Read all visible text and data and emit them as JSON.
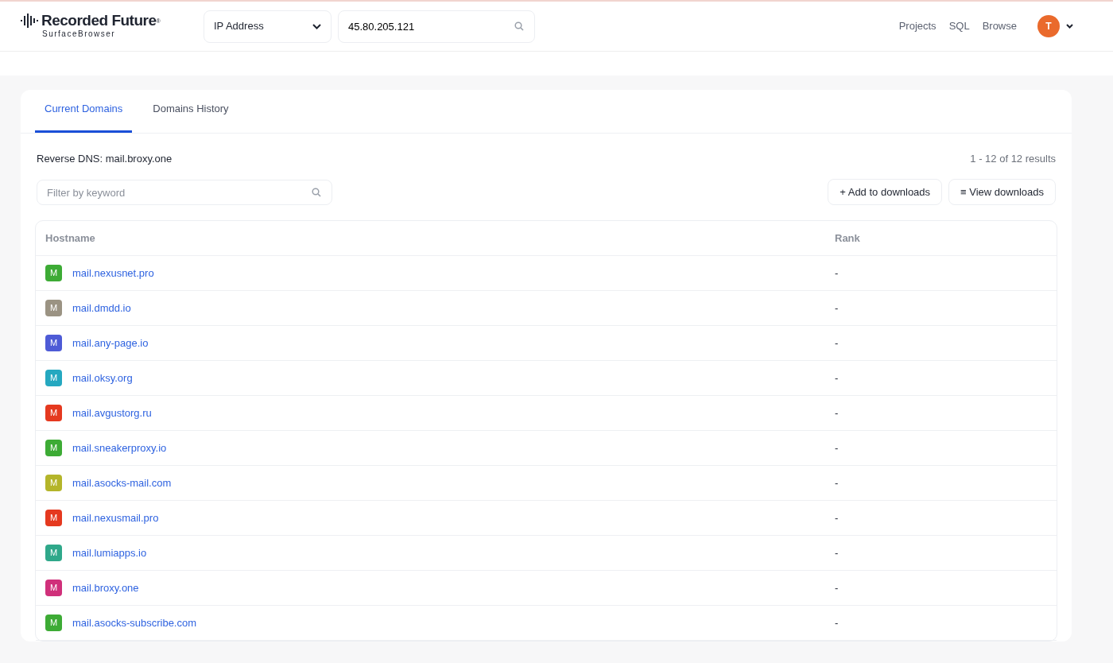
{
  "header": {
    "logo_name": "Recorded Future",
    "logo_mark": "®",
    "logo_product": "SurfaceBrowser",
    "search_type": "IP Address",
    "search_value": "45.80.205.121",
    "nav": [
      "Projects",
      "SQL",
      "Browse"
    ],
    "avatar": "T"
  },
  "tabs": [
    {
      "label": "Current Domains",
      "selected": true
    },
    {
      "label": "Domains History",
      "selected": false
    }
  ],
  "reverse_dns": {
    "label": "Reverse DNS:",
    "value": "mail.broxy.one"
  },
  "results": "1 - 12 of 12 results",
  "filter": {
    "placeholder": "Filter by keyword"
  },
  "buttons": [
    {
      "icon": "+",
      "label": "Add to downloads"
    },
    {
      "icon": "≡",
      "label": "View downloads"
    }
  ],
  "table": {
    "columns": [
      "Hostname",
      "Rank"
    ],
    "rows": [
      {
        "letter": "M",
        "color": "#3dab35",
        "hostname": "mail.nexusnet.pro",
        "rank": "-"
      },
      {
        "letter": "M",
        "color": "#9b9383",
        "hostname": "mail.dmdd.io",
        "rank": "-"
      },
      {
        "letter": "M",
        "color": "#4e5bd6",
        "hostname": "mail.any-page.io",
        "rank": "-"
      },
      {
        "letter": "M",
        "color": "#25a8c0",
        "hostname": "mail.oksy.org",
        "rank": "-"
      },
      {
        "letter": "M",
        "color": "#e5391f",
        "hostname": "mail.avgustorg.ru",
        "rank": "-"
      },
      {
        "letter": "M",
        "color": "#3dab35",
        "hostname": "mail.sneakerproxy.io",
        "rank": "-"
      },
      {
        "letter": "M",
        "color": "#b4b52a",
        "hostname": "mail.asocks-mail.com",
        "rank": "-"
      },
      {
        "letter": "M",
        "color": "#e5391f",
        "hostname": "mail.nexusmail.pro",
        "rank": "-"
      },
      {
        "letter": "M",
        "color": "#2fa88a",
        "hostname": "mail.lumiapps.io",
        "rank": "-"
      },
      {
        "letter": "M",
        "color": "#d0307a",
        "hostname": "mail.broxy.one",
        "rank": "-"
      },
      {
        "letter": "M",
        "color": "#3dab35",
        "hostname": "mail.asocks-subscribe.com",
        "rank": "-"
      }
    ]
  }
}
